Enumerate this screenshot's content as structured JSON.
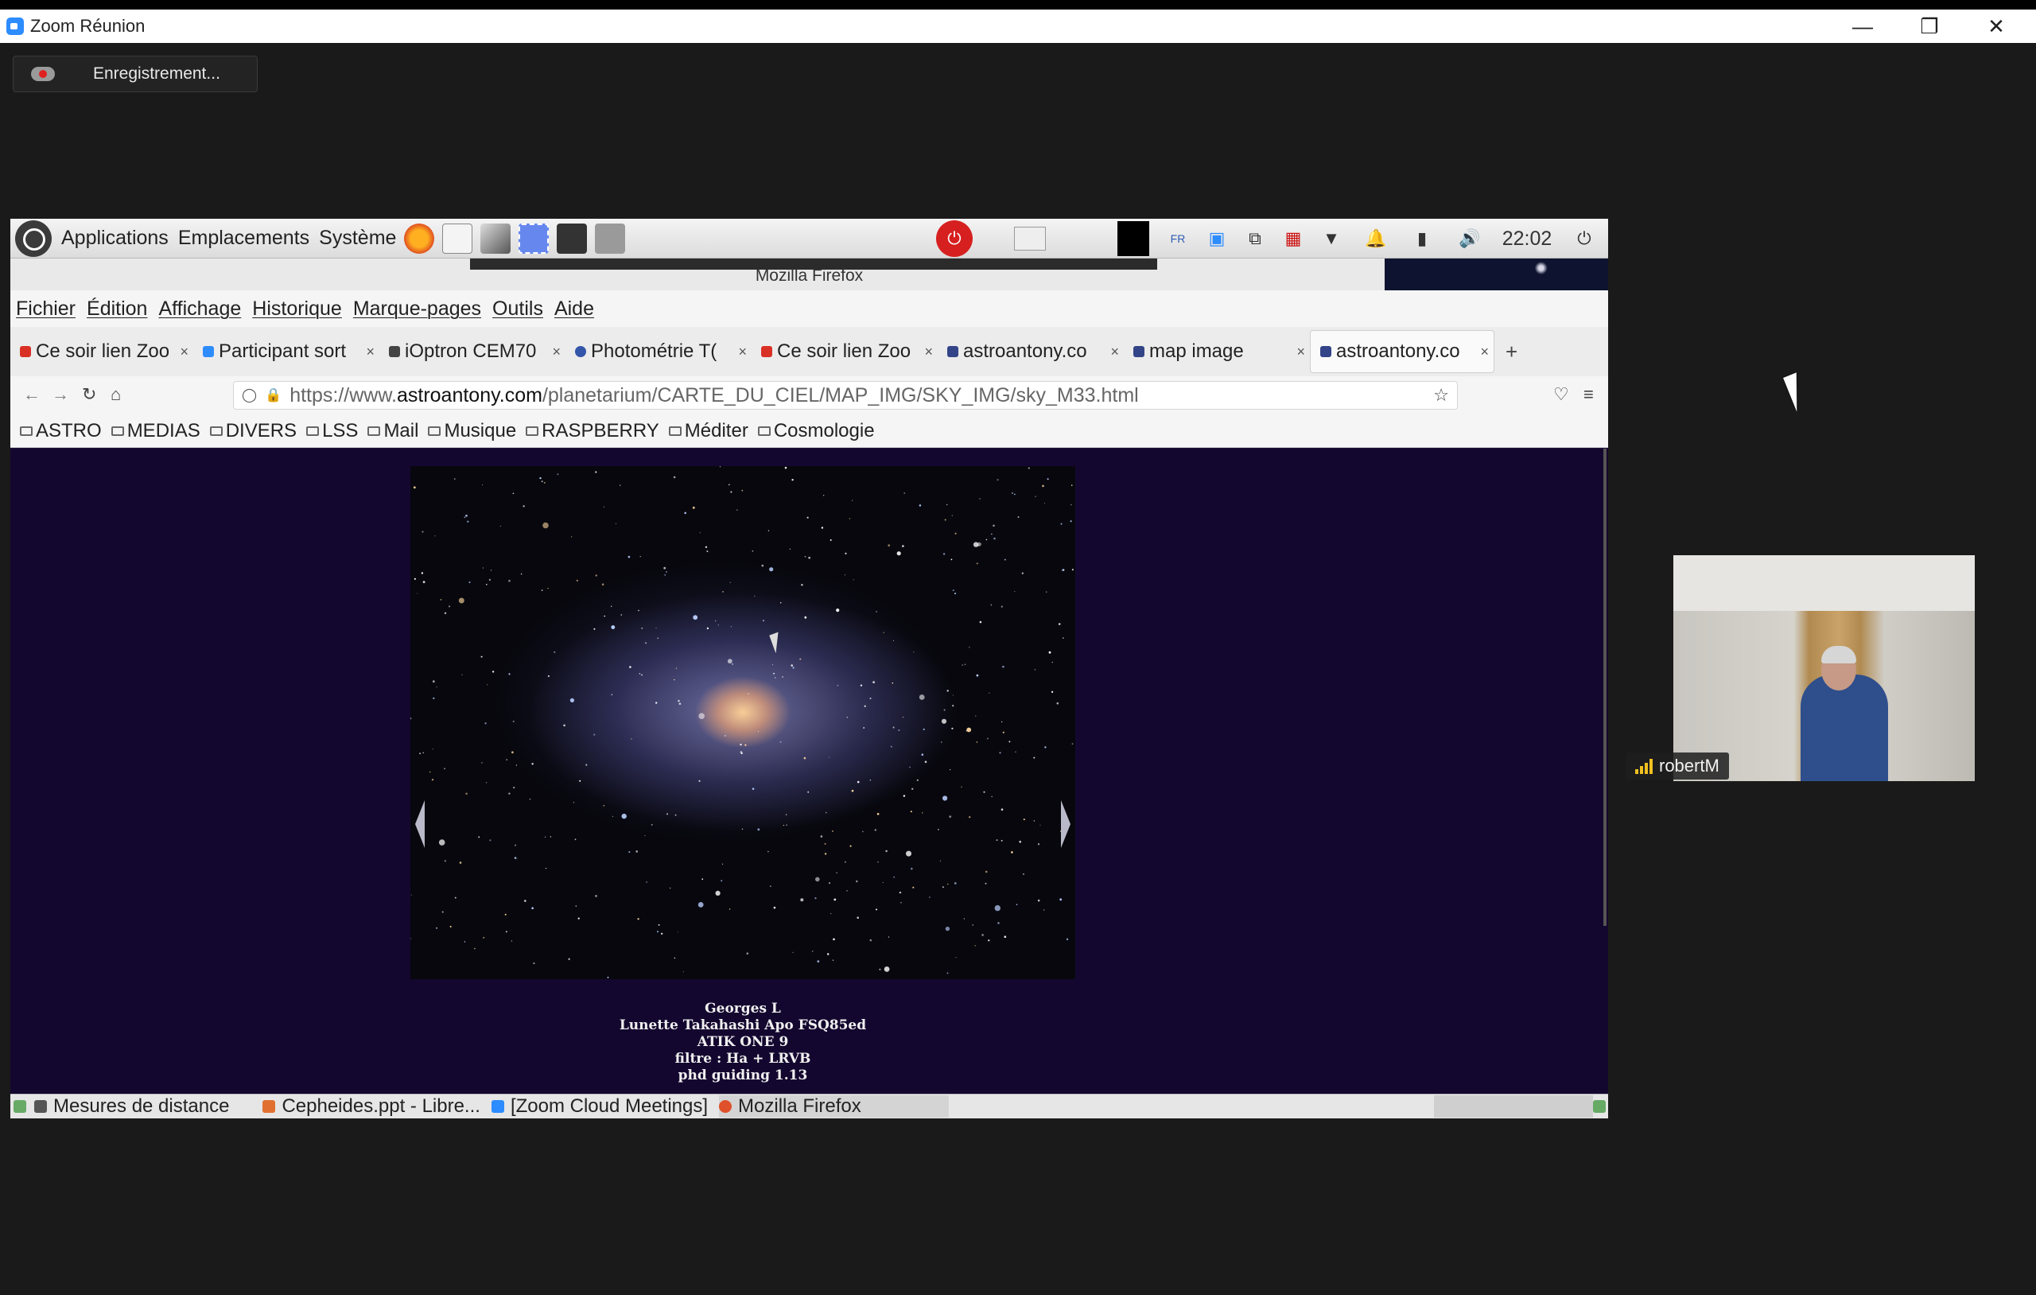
{
  "zoom": {
    "title": "Zoom Réunion",
    "recording_label": "Enregistrement...",
    "participant_name": "robertM"
  },
  "gnome_panel": {
    "menus": [
      "Applications",
      "Emplacements",
      "Système"
    ],
    "clock": "22:02",
    "keyboard_layout": "FR"
  },
  "firefox": {
    "window_title": "Mozilla Firefox",
    "menubar": [
      "Fichier",
      "Édition",
      "Affichage",
      "Historique",
      "Marque-pages",
      "Outils",
      "Aide"
    ],
    "tabs": [
      {
        "label": "Ce soir lien Zoo",
        "fav_color": "#d93025",
        "active": false
      },
      {
        "label": "Participant sort",
        "fav_color": "#2d8cff",
        "active": false
      },
      {
        "label": "iOptron CEM70",
        "fav_color": "#444444",
        "active": false
      },
      {
        "label": "Photométrie T(",
        "fav_color": "#3355aa",
        "active": false
      },
      {
        "label": "Ce soir lien Zoo",
        "fav_color": "#d93025",
        "active": false
      },
      {
        "label": "astroantony.co",
        "fav_color": "#334488",
        "active": false
      },
      {
        "label": "map image",
        "fav_color": "#334488",
        "active": false
      },
      {
        "label": "astroantony.co",
        "fav_color": "#334488",
        "active": true
      }
    ],
    "new_tab_label": "+",
    "url": {
      "prefix": "https://www.",
      "domain": "astroantony.com",
      "path": "/planetarium/CARTE_DU_CIEL/MAP_IMG/SKY_IMG/sky_M33.html"
    },
    "bookmarks": [
      "ASTRO",
      "MEDIAS",
      "DIVERS",
      "LSS",
      "Mail",
      "Musique",
      "RASPBERRY",
      "Méditer",
      "Cosmologie"
    ],
    "page": {
      "caption_lines": [
        "Georges L",
        "Lunette Takahashi Apo FSQ85ed",
        "ATIK ONE 9",
        "filtre : Ha + LRVB",
        "phd guiding 1.13"
      ]
    }
  },
  "taskbar": {
    "items": [
      {
        "label": "Mesures de distance",
        "icon_color": "#555555"
      },
      {
        "label": "Cepheides.ppt - Libre...",
        "icon_color": "#e07030"
      },
      {
        "label": "[Zoom Cloud Meetings]",
        "icon_color": "#2d8cff"
      },
      {
        "label": "Mozilla Firefox",
        "icon_color": "#e0502a"
      }
    ]
  }
}
